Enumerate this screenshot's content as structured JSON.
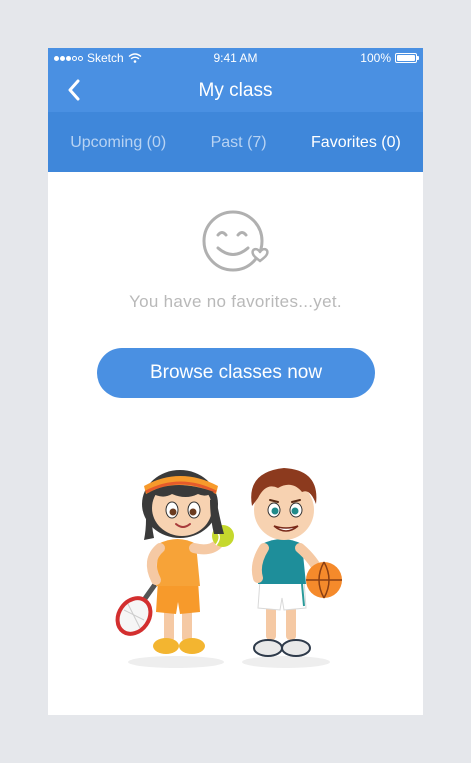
{
  "status_bar": {
    "carrier": "Sketch",
    "time": "9:41 AM",
    "battery": "100%"
  },
  "nav": {
    "title": "My class",
    "back_icon": "chevron-left-icon"
  },
  "tabs": [
    {
      "label": "Upcoming (0)",
      "active": false
    },
    {
      "label": "Past (7)",
      "active": false
    },
    {
      "label": "Favorites (0)",
      "active": true
    }
  ],
  "empty_state": {
    "icon": "smiley-heart-icon",
    "message": "You have no favorites...yet.",
    "button_label": "Browse classes now"
  },
  "colors": {
    "primary": "#4a90e2",
    "tab_bar": "#3f87da",
    "inactive_tab": "#b8d3f3",
    "muted_text": "#b9b9b9"
  }
}
